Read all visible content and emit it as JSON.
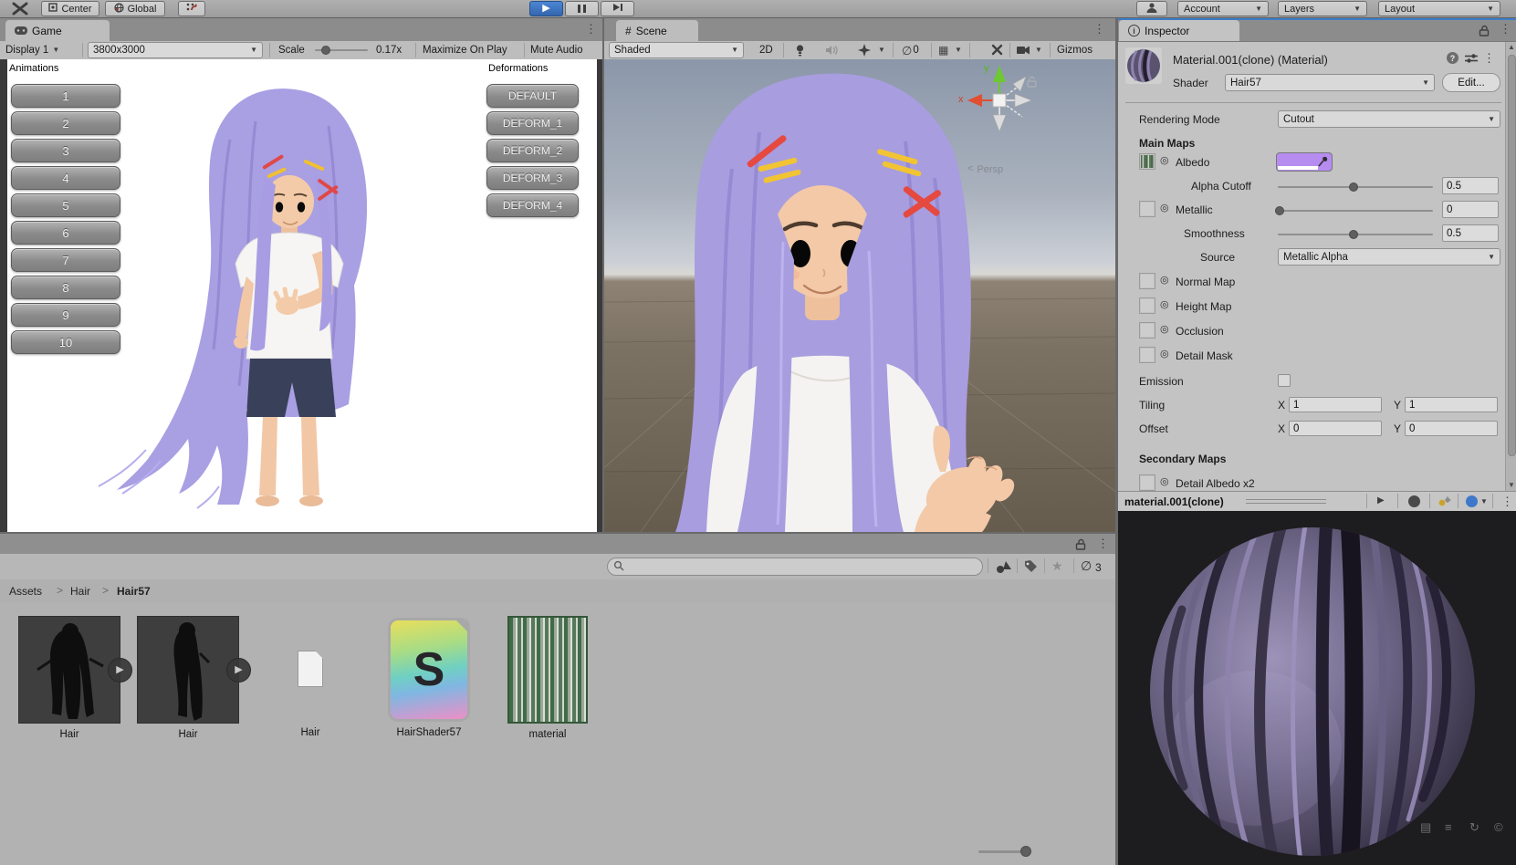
{
  "colors": {
    "play_active": "#3b74c4",
    "inspector_focus_accent": "#3d7cc9",
    "albedo_swatch": "#b78cf1",
    "character_hair": "#a89ddf"
  },
  "icons": {
    "dropdown": "▼",
    "more": "⋮",
    "chevron": ">",
    "back": "<",
    "star": "★",
    "hidden_eye": "∅",
    "target": "◎",
    "hash": "#",
    "help": "?",
    "info": "i",
    "play": "▶",
    "scroll_up": "▲",
    "scroll_down": "▼",
    "grid": "▦",
    "overlay_1": "▤",
    "overlay_2": "≡",
    "overlay_3": "↻",
    "overlay_4": "©"
  },
  "toolbar": {
    "center": "Center",
    "global": "Global",
    "account": "Account",
    "layers": "Layers",
    "layout": "Layout"
  },
  "game": {
    "tab": "Game",
    "display": "Display 1",
    "resolution": "3800x3000",
    "scale_label": "Scale",
    "scale_value": "0.17x",
    "maximize": "Maximize On Play",
    "mute": "Mute Audio",
    "animations_title": "Animations",
    "animations": [
      "1",
      "2",
      "3",
      "4",
      "5",
      "6",
      "7",
      "8",
      "9",
      "10"
    ],
    "deformations_title": "Deformations",
    "deformations": [
      "DEFAULT",
      "DEFORM_1",
      "DEFORM_2",
      "DEFORM_3",
      "DEFORM_4"
    ]
  },
  "scene": {
    "tab": "Scene",
    "shading": "Shaded",
    "btn_2d": "2D",
    "hidden_count": "0",
    "gizmos": "Gizmos",
    "persp": "Persp",
    "axis_x": "x",
    "axis_y": "y"
  },
  "inspector": {
    "tab": "Inspector",
    "title": "Material.001(clone) (Material)",
    "shader_label": "Shader",
    "shader_value": "Hair57",
    "edit": "Edit...",
    "rendering_mode_label": "Rendering Mode",
    "rendering_mode_value": "Cutout",
    "main_maps": "Main Maps",
    "albedo": "Albedo",
    "alpha_cutoff_label": "Alpha Cutoff",
    "alpha_cutoff_value": "0.5",
    "metallic_label": "Metallic",
    "metallic_value": "0",
    "smoothness_label": "Smoothness",
    "smoothness_value": "0.5",
    "source_label": "Source",
    "source_value": "Metallic Alpha",
    "normal_map": "Normal Map",
    "height_map": "Height Map",
    "occlusion": "Occlusion",
    "detail_mask": "Detail Mask",
    "emission": "Emission",
    "tiling_label": "Tiling",
    "offset_label": "Offset",
    "x_label": "X",
    "y_label": "Y",
    "tiling_x": "1",
    "tiling_y": "1",
    "offset_x": "0",
    "offset_y": "0",
    "secondary_maps": "Secondary Maps",
    "detail_albedo": "Detail Albedo x2"
  },
  "preview": {
    "title": "material.001(clone)"
  },
  "project": {
    "breadcrumb": [
      "Assets",
      "Hair",
      "Hair57"
    ],
    "hidden_count": "3",
    "search_placeholder": "",
    "items": [
      {
        "label": "Hair",
        "icon": "hair-model-icon"
      },
      {
        "label": "Hair",
        "icon": "hair-model-icon"
      },
      {
        "label": "Hair",
        "icon": "document-icon"
      },
      {
        "label": "HairShader57",
        "icon": "shader-icon"
      },
      {
        "label": "material",
        "icon": "texture-icon"
      }
    ]
  }
}
